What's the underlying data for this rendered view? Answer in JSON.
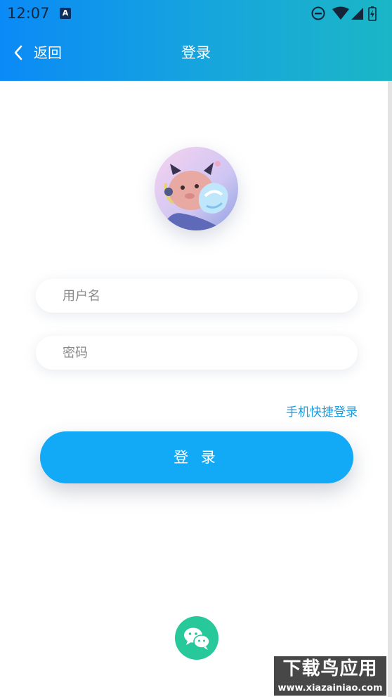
{
  "status_bar": {
    "time": "12:07",
    "app_icon_letter": "A",
    "icons": [
      "do-not-disturb-icon",
      "wifi-icon",
      "signal-icon",
      "battery-icon"
    ]
  },
  "nav": {
    "back_label": "返回",
    "title": "登录"
  },
  "form": {
    "username_placeholder": "用户名",
    "password_placeholder": "密码",
    "quick_login_label": "手机快捷登录",
    "login_button_label": "登 录"
  },
  "watermark": {
    "title": "下载鸟应用",
    "url": "www.xiazainiao.com"
  },
  "colors": {
    "header_gradient_start": "#0a8af6",
    "header_gradient_end": "#1bb6c6",
    "primary_button": "#12aaf6",
    "link": "#1b9be0",
    "wechat": "#27c89a"
  }
}
